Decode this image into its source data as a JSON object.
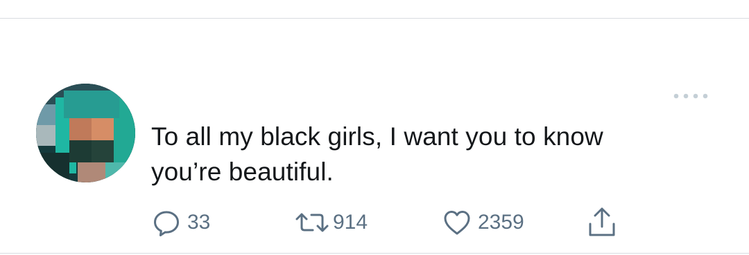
{
  "tweet": {
    "text_line_1": "To all my black girls, I want you to know",
    "text_line_2": "you’re beautiful.",
    "avatar_icon": "blurred-profile-photo"
  },
  "actions": {
    "reply": {
      "icon": "reply-icon",
      "count": "33"
    },
    "retweet": {
      "icon": "retweet-icon",
      "count": "914"
    },
    "like": {
      "icon": "heart-icon",
      "count": "2359"
    },
    "share": {
      "icon": "share-icon"
    }
  },
  "more": {
    "icon": "more-dots-icon"
  },
  "colors": {
    "text": "#14171a",
    "muted": "#5b7083",
    "divider": "#d8dce0",
    "dots": "#c4cfd6"
  }
}
